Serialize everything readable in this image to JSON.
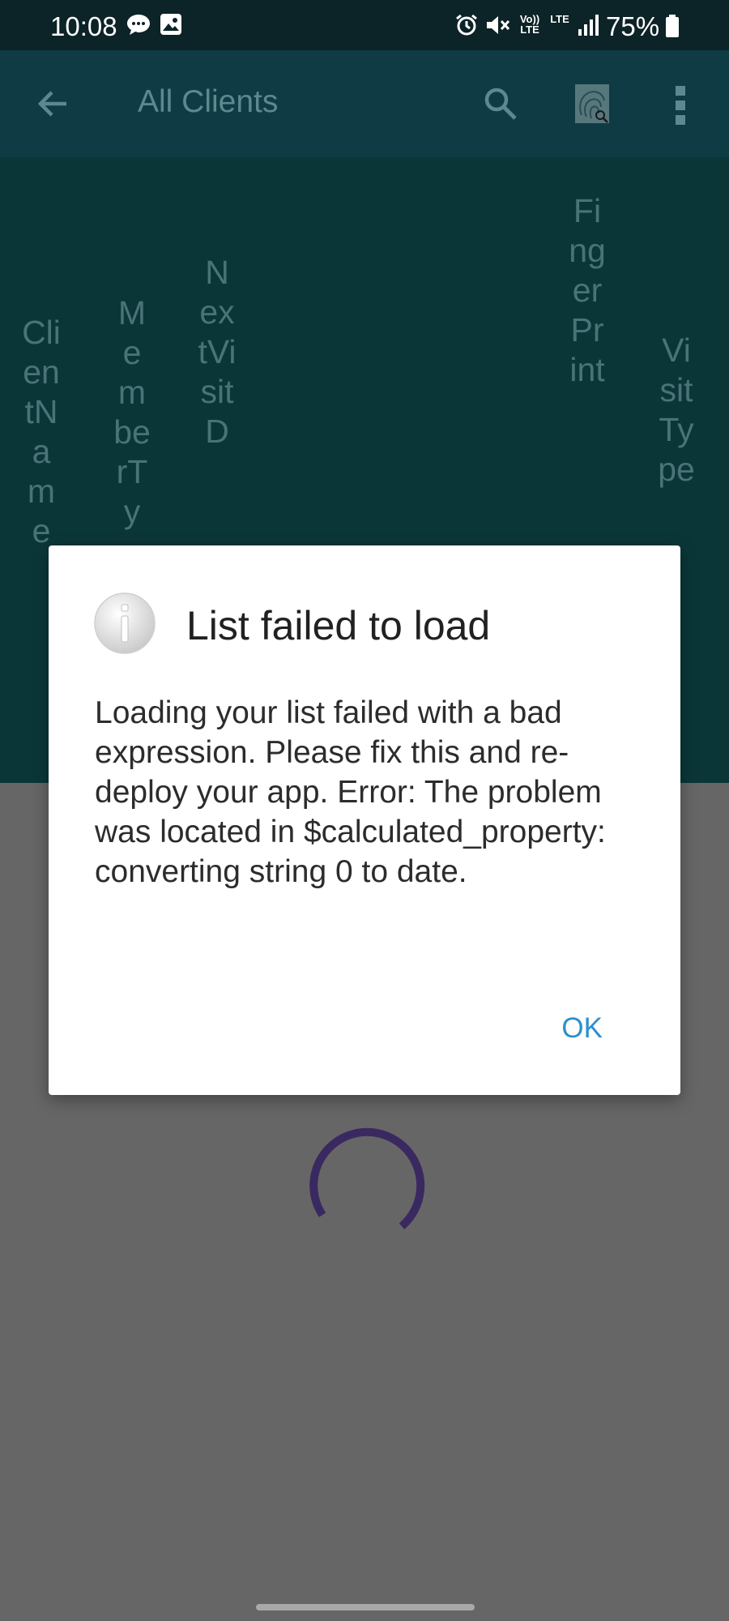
{
  "status_bar": {
    "time": "10:08",
    "battery": "75%",
    "volte": "Vo)) LTE",
    "lte": "LTE"
  },
  "app_bar": {
    "title": "All Clients",
    "icons": [
      "back-arrow-icon",
      "search-icon",
      "fingerprint-icon",
      "more-vert-icon"
    ]
  },
  "columns": [
    {
      "label": "ClientName"
    },
    {
      "label": "MemberTy"
    },
    {
      "label": "NextVisitD"
    },
    {
      "label": "FingerPrint"
    },
    {
      "label": "VisitType"
    }
  ],
  "dialog": {
    "title": "List failed to load",
    "message": "Loading your list failed with a bad expression. Please fix this and re-deploy your app. Error: The problem was located in $calculated_property: converting string 0 to date.",
    "ok_label": "OK",
    "icon": "info-icon"
  },
  "colors": {
    "app_bar": "#0f3b44",
    "header_band": "#0b3638",
    "scrim": "#666666",
    "accent": "#2c8fce",
    "spinner": "#3a2960"
  }
}
